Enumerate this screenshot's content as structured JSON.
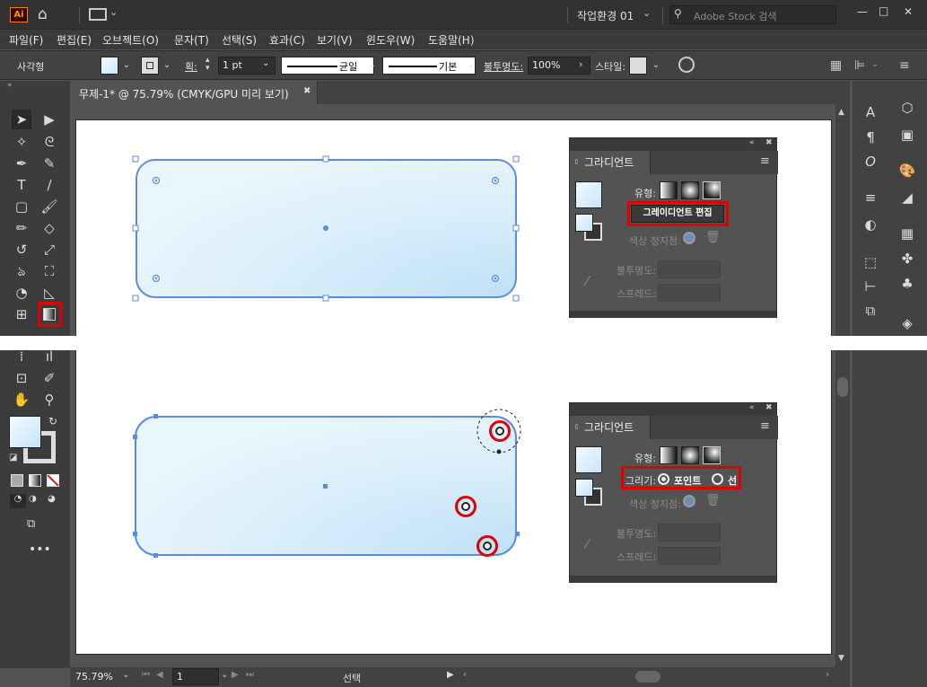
{
  "app": {
    "logo": "Ai",
    "workspace": "작업환경 01",
    "search_placeholder": "Adobe Stock 검색"
  },
  "menu": [
    "파일(F)",
    "편집(E)",
    "오브젝트(O)",
    "문자(T)",
    "선택(S)",
    "효과(C)",
    "보기(V)",
    "윈도우(W)",
    "도움말(H)"
  ],
  "control": {
    "object_type": "사각형",
    "stroke_label": "획:",
    "stroke_value": "1 pt",
    "profile": "균일",
    "brush": "기본",
    "opacity_label": "불투명도:",
    "opacity_value": "100%",
    "style_label": "스타일:"
  },
  "doc": {
    "tab_title": "무제-1* @ 75.79% (CMYK/GPU 미리 보기)",
    "close": "✖"
  },
  "gradient_panel_top": {
    "title": "그라디언트",
    "type_label": "유형:",
    "edit_button": "그레이디언트 편집",
    "stops_label": "색상 정지점:",
    "opacity_label": "불투명도:",
    "spread_label": "스프레드:"
  },
  "gradient_panel_bot": {
    "title": "그라디언트",
    "type_label": "유형:",
    "draw_label": "그리기:",
    "point_option": "포인트",
    "line_option": "선",
    "stops_label": "색상 정지점:",
    "opacity_label": "불투명도:",
    "spread_label": "스프레드:"
  },
  "status": {
    "zoom": "75.79%",
    "artboard": "1",
    "mode": "선택"
  },
  "window_buttons": {
    "min": "—",
    "max": "□",
    "close": "✕"
  },
  "colors": {
    "accent_red": "#e00000",
    "selection_blue": "#4a7fe0",
    "gradient_light": "#eaf6fd",
    "gradient_dark": "#c4e4f7"
  },
  "icons": [
    "home-icon",
    "workspace-layout-icon",
    "search-icon",
    "selection-tool-icon",
    "direct-selection-tool-icon",
    "magic-wand-icon",
    "lasso-icon",
    "pen-icon",
    "curvature-icon",
    "type-icon",
    "line-icon",
    "rectangle-icon",
    "paintbrush-icon",
    "pencil-icon",
    "eraser-icon",
    "rotate-icon",
    "scale-icon",
    "warp-icon",
    "free-transform-icon",
    "shape-builder-icon",
    "perspective-icon",
    "mesh-icon",
    "gradient-tool-icon",
    "hand-icon",
    "zoom-icon",
    "chart-icon",
    "globe-icon"
  ]
}
